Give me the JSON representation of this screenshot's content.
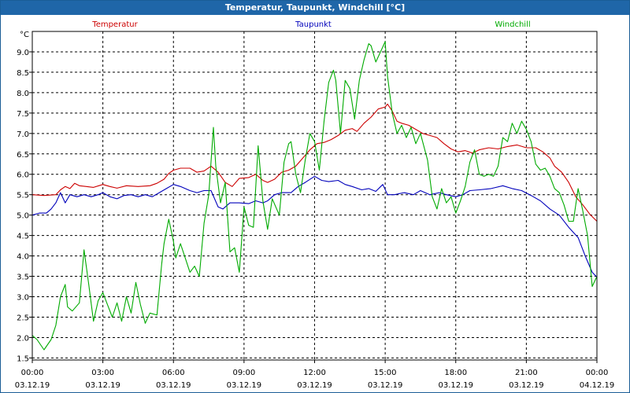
{
  "window": {
    "title": "Temperatur, Taupunkt, Windchill [°C]"
  },
  "chart_data": {
    "type": "line",
    "title": "Temperatur, Taupunkt, Windchill [°C]",
    "ylabel": "°C",
    "ylim": [
      1.45,
      9.5
    ],
    "xlim": [
      0,
      24
    ],
    "grid": true,
    "legend_placement": "top",
    "y_ticks": [
      "1.5",
      "2.0",
      "2.5",
      "3.0",
      "3.5",
      "4.0",
      "4.5",
      "5.0",
      "5.5",
      "6.0",
      "6.5",
      "7.0",
      "7.5",
      "8.0",
      "8.5",
      "9.0"
    ],
    "x_ticks": [
      {
        "x": 0,
        "time": "00:00",
        "date": "03.12.19"
      },
      {
        "x": 3,
        "time": "03:00",
        "date": "03.12.19"
      },
      {
        "x": 6,
        "time": "06:00",
        "date": "03.12.19"
      },
      {
        "x": 9,
        "time": "09:00",
        "date": "03.12.19"
      },
      {
        "x": 12,
        "time": "12:00",
        "date": "03.12.19"
      },
      {
        "x": 15,
        "time": "15:00",
        "date": "03.12.19"
      },
      {
        "x": 18,
        "time": "18:00",
        "date": "03.12.19"
      },
      {
        "x": 21,
        "time": "21:00",
        "date": "03.12.19"
      },
      {
        "x": 24,
        "time": "00:00",
        "date": "04.12.19"
      }
    ],
    "series": [
      {
        "name": "Temperatur",
        "color": "#cc0000",
        "points": [
          [
            0,
            5.5
          ],
          [
            0.5,
            5.48
          ],
          [
            1,
            5.5
          ],
          [
            1.2,
            5.62
          ],
          [
            1.4,
            5.7
          ],
          [
            1.6,
            5.65
          ],
          [
            1.8,
            5.78
          ],
          [
            2.0,
            5.72
          ],
          [
            2.3,
            5.7
          ],
          [
            2.6,
            5.68
          ],
          [
            3,
            5.75
          ],
          [
            3.3,
            5.7
          ],
          [
            3.6,
            5.66
          ],
          [
            4,
            5.72
          ],
          [
            4.5,
            5.7
          ],
          [
            5,
            5.72
          ],
          [
            5.3,
            5.78
          ],
          [
            5.6,
            5.88
          ],
          [
            5.8,
            6.02
          ],
          [
            6,
            6.1
          ],
          [
            6.3,
            6.15
          ],
          [
            6.7,
            6.15
          ],
          [
            7,
            6.05
          ],
          [
            7.3,
            6.08
          ],
          [
            7.6,
            6.2
          ],
          [
            7.9,
            6.05
          ],
          [
            8.2,
            5.8
          ],
          [
            8.5,
            5.7
          ],
          [
            8.8,
            5.9
          ],
          [
            9.2,
            5.92
          ],
          [
            9.5,
            6.0
          ],
          [
            9.8,
            5.85
          ],
          [
            10,
            5.8
          ],
          [
            10.3,
            5.88
          ],
          [
            10.6,
            6.05
          ],
          [
            10.9,
            6.1
          ],
          [
            11.2,
            6.2
          ],
          [
            11.5,
            6.4
          ],
          [
            11.8,
            6.6
          ],
          [
            12.1,
            6.75
          ],
          [
            12.4,
            6.78
          ],
          [
            12.7,
            6.85
          ],
          [
            13,
            6.95
          ],
          [
            13.3,
            7.08
          ],
          [
            13.6,
            7.12
          ],
          [
            13.8,
            7.05
          ],
          [
            14.1,
            7.25
          ],
          [
            14.4,
            7.4
          ],
          [
            14.7,
            7.6
          ],
          [
            15.0,
            7.65
          ],
          [
            15.1,
            7.72
          ],
          [
            15.3,
            7.55
          ],
          [
            15.5,
            7.3
          ],
          [
            15.7,
            7.25
          ],
          [
            16,
            7.2
          ],
          [
            16.3,
            7.1
          ],
          [
            16.6,
            7.0
          ],
          [
            16.9,
            6.95
          ],
          [
            17.2,
            6.9
          ],
          [
            17.5,
            6.75
          ],
          [
            17.8,
            6.62
          ],
          [
            18.1,
            6.55
          ],
          [
            18.4,
            6.58
          ],
          [
            18.7,
            6.52
          ],
          [
            19,
            6.6
          ],
          [
            19.4,
            6.65
          ],
          [
            19.8,
            6.62
          ],
          [
            20.2,
            6.68
          ],
          [
            20.6,
            6.72
          ],
          [
            21,
            6.65
          ],
          [
            21.4,
            6.65
          ],
          [
            21.7,
            6.55
          ],
          [
            22,
            6.4
          ],
          [
            22.2,
            6.2
          ],
          [
            22.5,
            6.05
          ],
          [
            22.8,
            5.8
          ],
          [
            23.1,
            5.45
          ],
          [
            23.4,
            5.25
          ],
          [
            23.7,
            5.02
          ],
          [
            24,
            4.85
          ]
        ]
      },
      {
        "name": "Taupunkt",
        "color": "#0000bb",
        "points": [
          [
            0,
            5.0
          ],
          [
            0.3,
            5.05
          ],
          [
            0.6,
            5.05
          ],
          [
            0.8,
            5.15
          ],
          [
            1.0,
            5.3
          ],
          [
            1.2,
            5.55
          ],
          [
            1.4,
            5.3
          ],
          [
            1.6,
            5.5
          ],
          [
            1.9,
            5.45
          ],
          [
            2.2,
            5.5
          ],
          [
            2.5,
            5.45
          ],
          [
            2.8,
            5.5
          ],
          [
            3.0,
            5.55
          ],
          [
            3.3,
            5.45
          ],
          [
            3.6,
            5.4
          ],
          [
            3.9,
            5.48
          ],
          [
            4.2,
            5.5
          ],
          [
            4.5,
            5.45
          ],
          [
            4.8,
            5.5
          ],
          [
            5.1,
            5.45
          ],
          [
            5.4,
            5.55
          ],
          [
            5.7,
            5.65
          ],
          [
            6.0,
            5.75
          ],
          [
            6.3,
            5.7
          ],
          [
            6.7,
            5.6
          ],
          [
            7.0,
            5.55
          ],
          [
            7.3,
            5.6
          ],
          [
            7.6,
            5.6
          ],
          [
            7.9,
            5.2
          ],
          [
            8.1,
            5.15
          ],
          [
            8.4,
            5.3
          ],
          [
            8.8,
            5.3
          ],
          [
            9.2,
            5.28
          ],
          [
            9.5,
            5.35
          ],
          [
            9.8,
            5.3
          ],
          [
            10.0,
            5.35
          ],
          [
            10.3,
            5.5
          ],
          [
            10.6,
            5.55
          ],
          [
            11,
            5.55
          ],
          [
            11.3,
            5.7
          ],
          [
            11.6,
            5.8
          ],
          [
            12,
            5.95
          ],
          [
            12.3,
            5.85
          ],
          [
            12.6,
            5.82
          ],
          [
            13,
            5.85
          ],
          [
            13.3,
            5.75
          ],
          [
            13.6,
            5.7
          ],
          [
            14,
            5.62
          ],
          [
            14.3,
            5.65
          ],
          [
            14.6,
            5.58
          ],
          [
            14.9,
            5.75
          ],
          [
            15.1,
            5.5
          ],
          [
            15.4,
            5.5
          ],
          [
            15.8,
            5.55
          ],
          [
            16.2,
            5.5
          ],
          [
            16.5,
            5.6
          ],
          [
            16.9,
            5.5
          ],
          [
            17.3,
            5.55
          ],
          [
            17.6,
            5.5
          ],
          [
            18,
            5.45
          ],
          [
            18.3,
            5.5
          ],
          [
            18.6,
            5.6
          ],
          [
            19,
            5.62
          ],
          [
            19.5,
            5.65
          ],
          [
            20,
            5.72
          ],
          [
            20.4,
            5.65
          ],
          [
            20.8,
            5.6
          ],
          [
            21.2,
            5.48
          ],
          [
            21.6,
            5.35
          ],
          [
            22,
            5.15
          ],
          [
            22.4,
            5.0
          ],
          [
            22.8,
            4.7
          ],
          [
            23.2,
            4.45
          ],
          [
            23.5,
            4.0
          ],
          [
            23.8,
            3.6
          ],
          [
            24,
            3.48
          ]
        ]
      },
      {
        "name": "Windchill",
        "color": "#00aa00",
        "points": [
          [
            0,
            2.05
          ],
          [
            0.2,
            1.95
          ],
          [
            0.5,
            1.7
          ],
          [
            0.8,
            1.95
          ],
          [
            1.0,
            2.3
          ],
          [
            1.2,
            3.0
          ],
          [
            1.4,
            3.3
          ],
          [
            1.5,
            2.75
          ],
          [
            1.7,
            2.65
          ],
          [
            2.0,
            2.85
          ],
          [
            2.2,
            4.15
          ],
          [
            2.4,
            3.3
          ],
          [
            2.6,
            2.4
          ],
          [
            2.8,
            2.9
          ],
          [
            3.0,
            3.1
          ],
          [
            3.2,
            2.8
          ],
          [
            3.4,
            2.5
          ],
          [
            3.6,
            2.85
          ],
          [
            3.8,
            2.4
          ],
          [
            4.0,
            3.0
          ],
          [
            4.2,
            2.6
          ],
          [
            4.4,
            3.35
          ],
          [
            4.6,
            2.8
          ],
          [
            4.8,
            2.35
          ],
          [
            5.0,
            2.6
          ],
          [
            5.3,
            2.55
          ],
          [
            5.5,
            3.8
          ],
          [
            5.6,
            4.3
          ],
          [
            5.8,
            4.9
          ],
          [
            6.0,
            4.35
          ],
          [
            6.1,
            3.95
          ],
          [
            6.3,
            4.3
          ],
          [
            6.5,
            3.95
          ],
          [
            6.7,
            3.6
          ],
          [
            6.9,
            3.75
          ],
          [
            7.1,
            3.5
          ],
          [
            7.3,
            4.8
          ],
          [
            7.5,
            5.5
          ],
          [
            7.7,
            7.15
          ],
          [
            7.8,
            6.2
          ],
          [
            8.0,
            5.3
          ],
          [
            8.2,
            5.8
          ],
          [
            8.4,
            4.1
          ],
          [
            8.6,
            4.2
          ],
          [
            8.8,
            3.6
          ],
          [
            9.0,
            5.2
          ],
          [
            9.2,
            4.75
          ],
          [
            9.4,
            4.7
          ],
          [
            9.6,
            6.7
          ],
          [
            9.8,
            5.35
          ],
          [
            10.0,
            4.65
          ],
          [
            10.2,
            5.4
          ],
          [
            10.5,
            5.0
          ],
          [
            10.7,
            6.3
          ],
          [
            10.9,
            6.75
          ],
          [
            11.0,
            6.8
          ],
          [
            11.2,
            6.0
          ],
          [
            11.4,
            5.55
          ],
          [
            11.6,
            6.35
          ],
          [
            11.8,
            7.0
          ],
          [
            12.0,
            6.8
          ],
          [
            12.2,
            6.1
          ],
          [
            12.4,
            7.3
          ],
          [
            12.6,
            8.25
          ],
          [
            12.8,
            8.55
          ],
          [
            12.9,
            8.3
          ],
          [
            13.1,
            7.0
          ],
          [
            13.3,
            8.3
          ],
          [
            13.5,
            8.1
          ],
          [
            13.7,
            7.35
          ],
          [
            13.9,
            8.3
          ],
          [
            14.1,
            8.8
          ],
          [
            14.3,
            9.2
          ],
          [
            14.4,
            9.15
          ],
          [
            14.6,
            8.75
          ],
          [
            14.8,
            9.0
          ],
          [
            15.0,
            9.25
          ],
          [
            15.1,
            8.4
          ],
          [
            15.3,
            7.5
          ],
          [
            15.5,
            7.0
          ],
          [
            15.7,
            7.2
          ],
          [
            15.9,
            6.9
          ],
          [
            16.1,
            7.15
          ],
          [
            16.3,
            6.75
          ],
          [
            16.5,
            7.0
          ],
          [
            16.8,
            6.35
          ],
          [
            17.0,
            5.45
          ],
          [
            17.2,
            5.15
          ],
          [
            17.4,
            5.65
          ],
          [
            17.6,
            5.3
          ],
          [
            17.8,
            5.45
          ],
          [
            18.0,
            5.05
          ],
          [
            18.2,
            5.35
          ],
          [
            18.4,
            5.7
          ],
          [
            18.6,
            6.3
          ],
          [
            18.8,
            6.6
          ],
          [
            19.0,
            6.0
          ],
          [
            19.2,
            5.95
          ],
          [
            19.4,
            6.0
          ],
          [
            19.6,
            5.95
          ],
          [
            19.8,
            6.2
          ],
          [
            20.0,
            6.9
          ],
          [
            20.2,
            6.8
          ],
          [
            20.4,
            7.25
          ],
          [
            20.6,
            7.0
          ],
          [
            20.8,
            7.3
          ],
          [
            21.0,
            7.1
          ],
          [
            21.2,
            6.8
          ],
          [
            21.4,
            6.25
          ],
          [
            21.6,
            6.1
          ],
          [
            21.8,
            6.15
          ],
          [
            22.0,
            5.95
          ],
          [
            22.2,
            5.65
          ],
          [
            22.4,
            5.55
          ],
          [
            22.6,
            5.25
          ],
          [
            22.8,
            4.85
          ],
          [
            23.0,
            4.85
          ],
          [
            23.2,
            5.65
          ],
          [
            23.4,
            5.1
          ],
          [
            23.6,
            4.5
          ],
          [
            23.8,
            3.25
          ],
          [
            24.0,
            3.5
          ]
        ]
      }
    ]
  }
}
